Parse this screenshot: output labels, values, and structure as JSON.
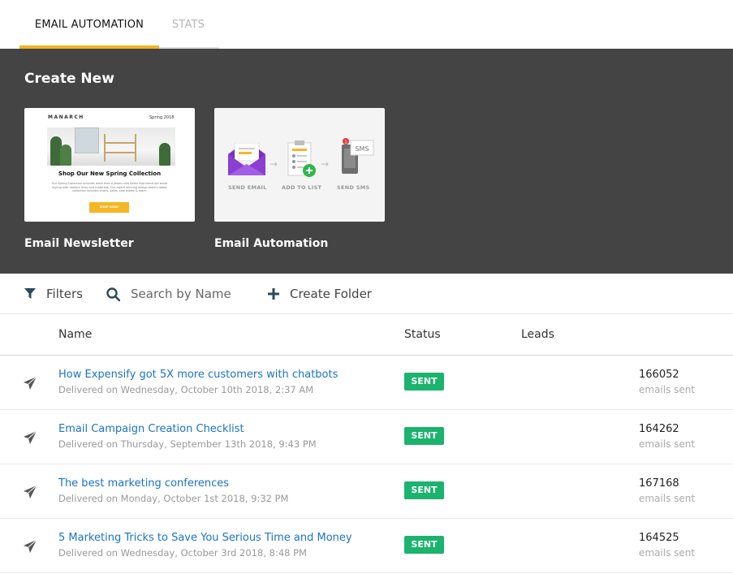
{
  "tabs": {
    "email_automation": "EMAIL AUTOMATION",
    "stats": "STATS",
    "active_color": "#f0b321"
  },
  "create_new": {
    "title": "Create New",
    "cards": [
      {
        "label": "Email Newsletter",
        "thumbnail": {
          "brand": "MANARCH",
          "season": "Spring 2018",
          "heading": "Shop Our New Spring Collection",
          "body": "Our Spring Collection includes more than a dozen new items that blend old world styling with modern lines and materials. Our award-winning design team's latest collection includes chairs, sofas, side tables & more.",
          "button": "SHOP NOW!"
        }
      },
      {
        "label": "Email Automation",
        "thumbnail": {
          "steps": [
            "SEND EMAIL",
            "ADD TO LIST",
            "SEND SMS"
          ],
          "sms_text": "SMS",
          "notification_count": "1"
        }
      }
    ]
  },
  "toolbar": {
    "filters": "Filters",
    "search_placeholder": "Search by Name",
    "create_folder": "Create Folder"
  },
  "table": {
    "columns": {
      "name": "Name",
      "status": "Status",
      "leads": "Leads"
    },
    "rows": [
      {
        "title": "How Expensify got 5X more customers with chatbots",
        "delivered": "Delivered on Wednesday, October 10th 2018, 2:37 AM",
        "status": "SENT",
        "count": "166052",
        "count_label": "emails sent"
      },
      {
        "title": "Email Campaign Creation Checklist",
        "delivered": "Delivered on Thursday, September 13th 2018, 9:43 PM",
        "status": "SENT",
        "count": "164262",
        "count_label": "emails sent"
      },
      {
        "title": "The best marketing conferences",
        "delivered": "Delivered on Monday, October 1st 2018, 9:32 PM",
        "status": "SENT",
        "count": "167168",
        "count_label": "emails sent"
      },
      {
        "title": "5 Marketing Tricks to Save You Serious Time and Money",
        "delivered": "Delivered on Wednesday, October 3rd 2018, 8:48 PM",
        "status": "SENT",
        "count": "164525",
        "count_label": "emails sent"
      }
    ]
  },
  "colors": {
    "panel_bg": "#444444",
    "link": "#1a73c9",
    "sent_badge": "#1bb36d",
    "filter_icon": "#2c4a5a"
  }
}
